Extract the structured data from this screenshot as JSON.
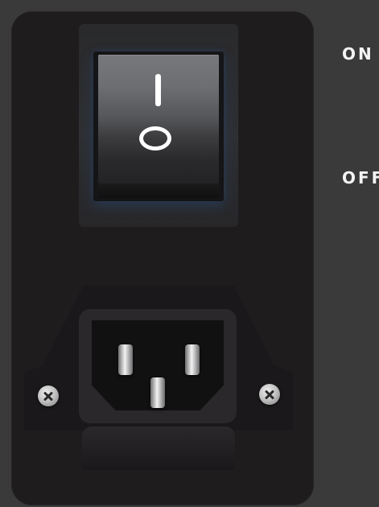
{
  "labels": {
    "on": "ON",
    "off": "OFF"
  },
  "switch": {
    "on_symbol": "I",
    "off_symbol": "O"
  },
  "icons": {
    "screw_left": "screw-icon",
    "screw_right": "screw-icon"
  },
  "colors": {
    "background": "#3a3a3b",
    "panel": "#1f1c1e",
    "label_text": "#f4f4f4"
  }
}
